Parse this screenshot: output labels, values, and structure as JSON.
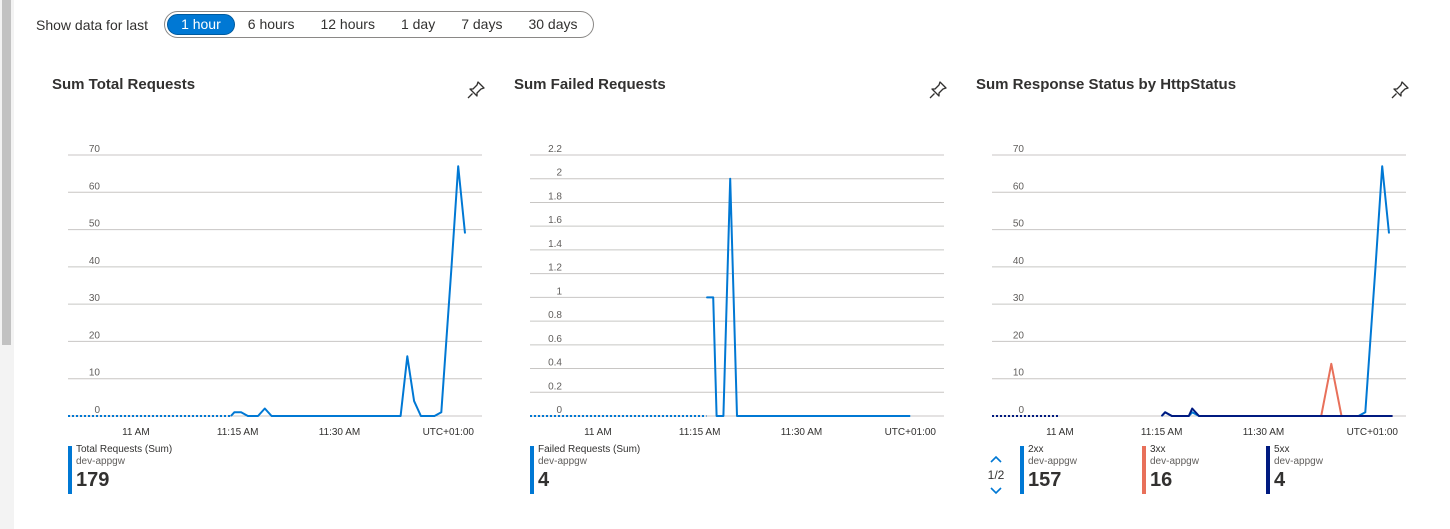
{
  "timebar": {
    "label": "Show data for last",
    "options": [
      "1 hour",
      "6 hours",
      "12 hours",
      "1 day",
      "7 days",
      "30 days"
    ],
    "selected": "1 hour"
  },
  "colors": {
    "accent": "#0078d4",
    "series_2xx": "#0078d4",
    "series_3xx": "#e8705a",
    "series_5xx": "#001a80",
    "grid": "#c8c6c4"
  },
  "cards": [
    {
      "title": "Sum Total Requests",
      "pin_icon": "pin-icon",
      "legend": [
        {
          "name": "Total Requests (Sum)",
          "sub": "dev-appgw",
          "value": "179",
          "color": "#0078d4"
        }
      ]
    },
    {
      "title": "Sum Failed Requests",
      "pin_icon": "pin-icon",
      "legend": [
        {
          "name": "Failed Requests (Sum)",
          "sub": "dev-appgw",
          "value": "4",
          "color": "#0078d4"
        }
      ]
    },
    {
      "title": "Sum Response Status by HttpStatus",
      "pin_icon": "pin-icon",
      "pager": {
        "label": "1/2",
        "up_icon": "chevron-up-icon",
        "down_icon": "chevron-down-icon"
      },
      "legend": [
        {
          "name": "2xx",
          "sub": "dev-appgw",
          "value": "157",
          "color": "#0078d4"
        },
        {
          "name": "3xx",
          "sub": "dev-appgw",
          "value": "16",
          "color": "#e8705a"
        },
        {
          "name": "5xx",
          "sub": "dev-appgw",
          "value": "4",
          "color": "#001a80"
        }
      ]
    }
  ],
  "chart_data": [
    {
      "type": "line",
      "title": "Sum Total Requests",
      "ylim": [
        0,
        70
      ],
      "yticks": [
        0,
        10,
        20,
        30,
        40,
        50,
        60,
        70
      ],
      "xticks": [
        "11 AM",
        "11:15 AM",
        "11:30 AM"
      ],
      "xtick_minutes": [
        0,
        15,
        30
      ],
      "xlim_minutes": [
        -10,
        51
      ],
      "timezone": "UTC+01:00",
      "grid": true,
      "series": [
        {
          "name": "Total Requests (Sum)",
          "color": "#0078d4",
          "dotted_until_minutes": 14,
          "points": [
            [
              -10,
              0
            ],
            [
              14,
              0
            ],
            [
              14.5,
              1
            ],
            [
              15.5,
              1
            ],
            [
              16.5,
              0
            ],
            [
              18,
              0
            ],
            [
              19,
              2
            ],
            [
              20,
              0
            ],
            [
              39,
              0
            ],
            [
              40,
              16
            ],
            [
              41,
              4
            ],
            [
              42,
              0
            ],
            [
              44,
              0
            ],
            [
              45,
              1
            ],
            [
              46.5,
              40
            ],
            [
              47.5,
              67
            ],
            [
              48.5,
              49
            ]
          ]
        }
      ]
    },
    {
      "type": "line",
      "title": "Sum Failed Requests",
      "ylim": [
        0,
        2.2
      ],
      "yticks": [
        0,
        0.2,
        0.4,
        0.6,
        0.8,
        1,
        1.2,
        1.4,
        1.6,
        1.8,
        2,
        2.2
      ],
      "xticks": [
        "11 AM",
        "11:15 AM",
        "11:30 AM"
      ],
      "xtick_minutes": [
        0,
        15,
        30
      ],
      "xlim_minutes": [
        -10,
        51
      ],
      "timezone": "UTC+01:00",
      "grid": true,
      "series": [
        {
          "name": "Failed Requests (Sum)",
          "color": "#0078d4",
          "dotted_until_minutes": 16,
          "points": [
            [
              -10,
              0
            ],
            [
              15.5,
              0
            ],
            [
              16,
              1
            ],
            [
              17,
              1
            ],
            [
              17.5,
              0
            ],
            [
              18.5,
              0
            ],
            [
              19.5,
              2
            ],
            [
              20.5,
              0
            ],
            [
              46,
              0
            ]
          ]
        }
      ]
    },
    {
      "type": "line",
      "title": "Sum Response Status by HttpStatus",
      "ylim": [
        0,
        70
      ],
      "yticks": [
        0,
        10,
        20,
        30,
        40,
        50,
        60,
        70
      ],
      "xticks": [
        "11 AM",
        "11:15 AM",
        "11:30 AM"
      ],
      "xtick_minutes": [
        0,
        15,
        30
      ],
      "xlim_minutes": [
        -10,
        51
      ],
      "timezone": "UTC+01:00",
      "grid": true,
      "series": [
        {
          "name": "2xx",
          "color": "#0078d4",
          "dotted_until_minutes": 0,
          "points": [
            [
              -10,
              0
            ],
            [
              15,
              0
            ],
            [
              15.5,
              1
            ],
            [
              16.5,
              0
            ],
            [
              19,
              0
            ],
            [
              19.5,
              1
            ],
            [
              20.5,
              0
            ],
            [
              44,
              0
            ],
            [
              45,
              1
            ],
            [
              46.5,
              40
            ],
            [
              47.5,
              67
            ],
            [
              48.5,
              49
            ]
          ]
        },
        {
          "name": "3xx",
          "color": "#e8705a",
          "dotted_until_minutes": 0,
          "points": [
            [
              -10,
              0
            ],
            [
              38.5,
              0
            ],
            [
              40,
              14
            ],
            [
              41.5,
              0
            ],
            [
              49,
              0
            ]
          ]
        },
        {
          "name": "5xx",
          "color": "#001a80",
          "dotted_until_minutes": 0,
          "points": [
            [
              -10,
              0
            ],
            [
              15,
              0
            ],
            [
              15.5,
              1
            ],
            [
              16.5,
              0
            ],
            [
              19,
              0
            ],
            [
              19.5,
              2
            ],
            [
              20.5,
              0
            ],
            [
              49,
              0
            ]
          ]
        }
      ]
    }
  ]
}
